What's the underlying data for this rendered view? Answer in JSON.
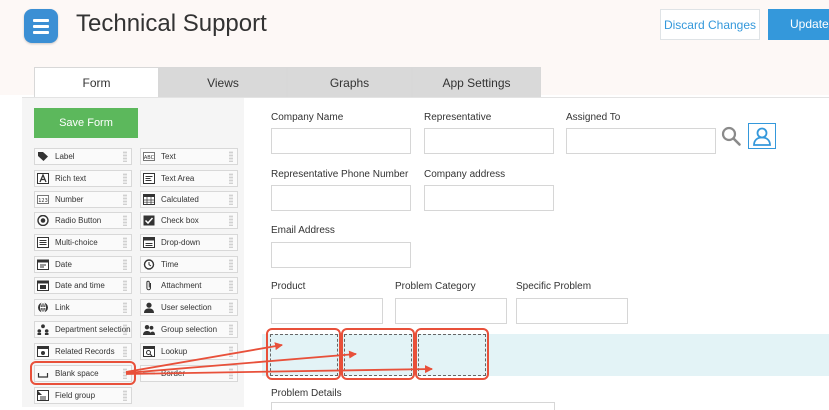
{
  "header": {
    "title": "Technical Support",
    "discard_label": "Discard Changes",
    "update_label": "Update A"
  },
  "tabs": [
    {
      "label": "Form",
      "active": true
    },
    {
      "label": "Views",
      "active": false
    },
    {
      "label": "Graphs",
      "active": false
    },
    {
      "label": "App Settings",
      "active": false
    }
  ],
  "sidebar": {
    "save_label": "Save Form",
    "left_widgets": [
      {
        "label": "Label",
        "icon": "tag-icon"
      },
      {
        "label": "Rich text",
        "icon": "rich-text-icon"
      },
      {
        "label": "Number",
        "icon": "number-icon"
      },
      {
        "label": "Radio Button",
        "icon": "radio-icon"
      },
      {
        "label": "Multi-choice",
        "icon": "multi-choice-icon"
      },
      {
        "label": "Date",
        "icon": "date-icon"
      },
      {
        "label": "Date and time",
        "icon": "date-time-icon"
      },
      {
        "label": "Link",
        "icon": "link-icon"
      },
      {
        "label": "Department selection",
        "icon": "department-icon"
      },
      {
        "label": "Related Records",
        "icon": "related-records-icon"
      },
      {
        "label": "Blank space",
        "icon": "blank-space-icon"
      },
      {
        "label": "Field group",
        "icon": "field-group-icon"
      }
    ],
    "right_widgets": [
      {
        "label": "Text",
        "icon": "text-icon"
      },
      {
        "label": "Text Area",
        "icon": "text-area-icon"
      },
      {
        "label": "Calculated",
        "icon": "calculated-icon"
      },
      {
        "label": "Check box",
        "icon": "checkbox-icon"
      },
      {
        "label": "Drop-down",
        "icon": "dropdown-icon"
      },
      {
        "label": "Time",
        "icon": "time-icon"
      },
      {
        "label": "Attachment",
        "icon": "attachment-icon"
      },
      {
        "label": "User selection",
        "icon": "user-selection-icon"
      },
      {
        "label": "Group selection",
        "icon": "group-selection-icon"
      },
      {
        "label": "Lookup",
        "icon": "lookup-icon"
      },
      {
        "label": "Border",
        "icon": "border-icon"
      }
    ]
  },
  "form": {
    "fields": [
      {
        "label": "Company Name"
      },
      {
        "label": "Representative"
      },
      {
        "label": "Assigned To"
      },
      {
        "label": "Representative Phone Number"
      },
      {
        "label": "Company address"
      },
      {
        "label": "Email Address"
      },
      {
        "label": "Product"
      },
      {
        "label": "Problem Category"
      },
      {
        "label": "Specific Problem"
      },
      {
        "label": "Problem Details"
      }
    ]
  },
  "colors": {
    "accent_blue": "#3498db",
    "save_green": "#5cb85c",
    "annotation_red": "#e8503a",
    "highlight_row": "#e3f3f6"
  }
}
